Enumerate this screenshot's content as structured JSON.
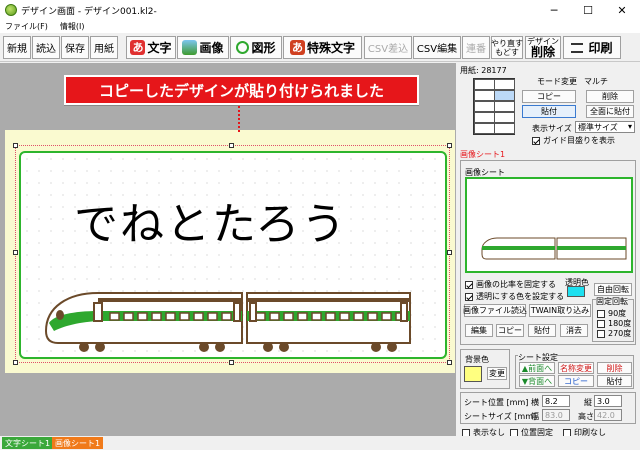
{
  "window": {
    "title": "デザイン画面 - デザイン001.kl2-",
    "minimize": "─",
    "maximize": "☐",
    "close": "✕"
  },
  "menu": [
    "ファイル(F)",
    "情報(I)"
  ],
  "toolbar": {
    "new": "新規",
    "open": "読込",
    "save": "保存",
    "paper": "用紙",
    "text": "文字",
    "text_icon": "あ",
    "image": "画像",
    "shape": "図形",
    "special_text": "特殊文字",
    "special_icon": "あ",
    "csv_insert": "CSV差込",
    "csv_edit": "CSV編集",
    "link": "連番",
    "redo": "やり直す",
    "undo": "もどす",
    "delete_top": "デザイン",
    "delete": "削除",
    "print": "印刷"
  },
  "canvas": {
    "message": "コピーしたデザインが貼り付けられました",
    "card_text": "でねとたろう"
  },
  "panel": {
    "paper_code": "用紙: 28177",
    "mode_change": "モード変更",
    "multi": "マルチ",
    "copy": "コピー",
    "delete": "削除",
    "paste": "貼付",
    "paste_all": "全面に貼付",
    "display_size_label": "表示サイズ",
    "display_size_value": "標準サイズ",
    "show_guide": "ガイド目盛りを表示",
    "sheet_title": "画像シート1",
    "sheet_group": "画像シート",
    "fix_ratio": "画像の比率を固定する",
    "transparent": "透明にする色を設定する",
    "transparent_color_label": "透明色",
    "free_rotate": "自由回転",
    "image_file": "画像ファイル読込",
    "twain": "TWAIN取り込み",
    "edit": "編集",
    "copy2": "コピー",
    "paste2": "貼付",
    "erase": "消去",
    "fixed_rotate": "固定回転",
    "rot90": "90度",
    "rot180": "180度",
    "rot270": "270度",
    "bg_color": "背景色",
    "change": "変更",
    "sheet_settings": "シート設定",
    "bring_front": "▲前面へ",
    "send_back": "▼背面へ",
    "rename": "名称変更",
    "delete3": "削除",
    "copy3": "コピー",
    "paste3": "貼付",
    "sheet_pos": "シート位置 [mm]",
    "x_label": "横",
    "x_value": "8.2",
    "y_label": "縦",
    "y_value": "3.0",
    "sheet_size": "シートサイズ [mm]",
    "w_label": "幅",
    "w_value": "83.0",
    "h_label": "高さ",
    "h_value": "42.0",
    "hide": "表示なし",
    "fix_pos": "位置固定",
    "no_print": "印刷なし"
  },
  "tabs": [
    "文字シート1",
    "画像シート1"
  ],
  "colors": {
    "accent": "#e6161a",
    "border_green": "#2db52d",
    "cyan": "#1ee0f0",
    "bg_yellow": "#ffff80"
  }
}
